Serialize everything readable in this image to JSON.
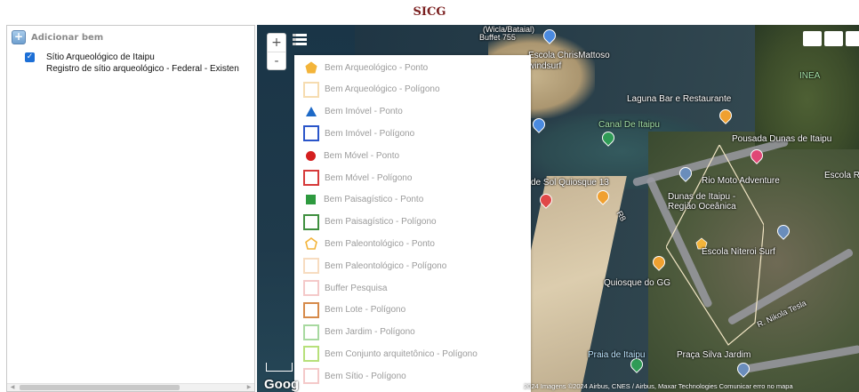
{
  "app": {
    "title": "SICG"
  },
  "left_panel": {
    "add_label": "Adicionar bem",
    "items": [
      {
        "checked": true,
        "name": "Sítio Arqueológico de Itaipu",
        "detail": "Registro de sítio arqueológico - Federal - Existen"
      }
    ]
  },
  "map": {
    "zoom_in": "+",
    "zoom_out": "-",
    "google_logo": "Goog",
    "attribution": "2024 Imagens ©2024 Airbus, CNES / Airbus, Maxar Technologies  Comunicar erro no mapa",
    "labels": [
      {
        "text": "Buffet 755"
      },
      {
        "text": "(Wicla/Bataial)"
      },
      {
        "text": "Escola ChrisMattoso"
      },
      {
        "text": "windsurf"
      },
      {
        "text": "INEA"
      },
      {
        "text": "Laguna Bar e Restaurante"
      },
      {
        "text": "Canal De Itaipu"
      },
      {
        "text": "Pousada Dunas de Itaipu"
      },
      {
        "text": "Rio Moto Adventure"
      },
      {
        "text": "Escola Rayza"
      },
      {
        "text": "de Sol Quiosque 13"
      },
      {
        "text": "Dunas de Itaipu -"
      },
      {
        "text": "Região Oceânica"
      },
      {
        "text": "Escola Niteroi Surf"
      },
      {
        "text": "Quiosque do GG"
      },
      {
        "text": "R. Nikola Tesla"
      },
      {
        "text": "Praia de Itaipu"
      },
      {
        "text": "Praça Silva Jardim"
      },
      {
        "text": "R8"
      }
    ]
  },
  "legend": {
    "items": [
      {
        "label": "Bem Arqueológico - Ponto",
        "symbol": "pentagon-fill",
        "color": "#f3b43a"
      },
      {
        "label": "Bem Arqueológico - Polígono",
        "symbol": "square-outline",
        "color": "#f6dcb0"
      },
      {
        "label": "Bem Imóvel - Ponto",
        "symbol": "triangle-fill",
        "color": "#1d69c7"
      },
      {
        "label": "Bem Imóvel - Polígono",
        "symbol": "square-outline",
        "color": "#2a55c9"
      },
      {
        "label": "Bem Móvel - Ponto",
        "symbol": "circle-fill",
        "color": "#d41f1f"
      },
      {
        "label": "Bem Móvel - Polígono",
        "symbol": "square-outline",
        "color": "#d63a3a"
      },
      {
        "label": "Bem Paisagístico - Ponto",
        "symbol": "square-fill",
        "color": "#2e9a3f"
      },
      {
        "label": "Bem Paisagístico - Polígono",
        "symbol": "square-outline",
        "color": "#3f8f3f"
      },
      {
        "label": "Bem Paleontológico - Ponto",
        "symbol": "pentagon-outline",
        "color": "#f3b43a"
      },
      {
        "label": "Bem Paleontológico - Polígono",
        "symbol": "square-outline",
        "color": "#f7dcc0"
      },
      {
        "label": "Buffer Pesquisa",
        "symbol": "square-outline",
        "color": "#f4c9c9"
      },
      {
        "label": "Bem Lote - Polígono",
        "symbol": "square-outline",
        "color": "#d68a4a"
      },
      {
        "label": "Bem Jardim - Polígono",
        "symbol": "square-outline",
        "color": "#a8d9a0"
      },
      {
        "label": "Bem Conjunto arquitetônico - Polígono",
        "symbol": "square-outline",
        "color": "#b7e07a"
      },
      {
        "label": "Bem Sítio - Polígono",
        "symbol": "square-outline",
        "color": "#f4c9c9"
      }
    ]
  }
}
